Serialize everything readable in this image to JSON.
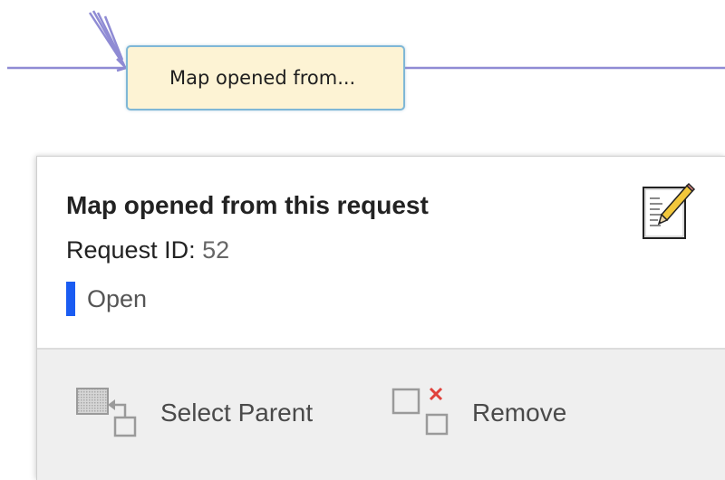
{
  "map_node": {
    "label": "Map opened from..."
  },
  "popup": {
    "title": "Map opened from this request",
    "request_id_label": "Request ID:",
    "request_id_value": "52",
    "status": "Open",
    "edit_icon": "edit-notepad-icon",
    "actions": [
      {
        "label": "Select Parent",
        "icon": "select-parent-icon"
      },
      {
        "label": "Remove",
        "icon": "remove-node-icon"
      }
    ]
  },
  "colors": {
    "connector_line": "#8f8bd4",
    "node_fill": "#fdf3d4",
    "node_border": "#7fb7d6",
    "status_accent": "#1a5cf2",
    "remove_accent": "#e0413b",
    "footer_background": "#efefef"
  }
}
